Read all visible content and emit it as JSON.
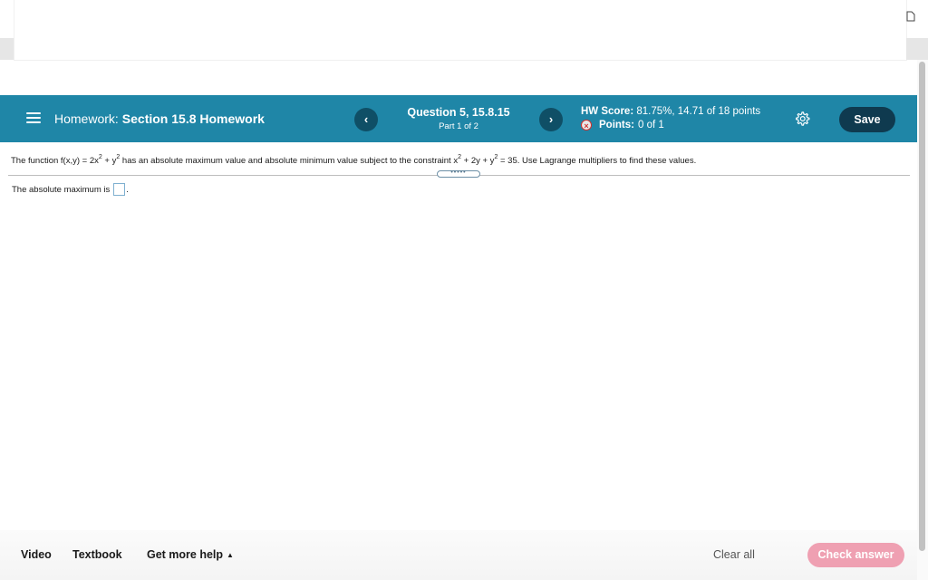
{
  "header": {
    "homework_prefix": "Homework:",
    "homework_name": "Section 15.8 Homework",
    "prev_icon": "chevron-left-icon",
    "next_icon": "chevron-right-icon",
    "prev_glyph": "‹",
    "next_glyph": "›",
    "question_title": "Question 5, 15.8.15",
    "question_part": "Part 1 of 2",
    "hw_score_label": "HW Score:",
    "hw_score_value": "81.75%, 14.71 of 18 points",
    "points_label": "Points:",
    "points_value": "0 of 1",
    "save_label": "Save",
    "colors": {
      "bar": "#1f86a7",
      "nav_button": "#0f4f66",
      "save_button": "#0f3a4f"
    }
  },
  "problem": {
    "part1": "The function f(x,y) = 2x",
    "sup1": "2",
    "part2": " + y",
    "sup2": "2",
    "part3": "  has an absolute maximum value and absolute minimum value subject to the constraint x",
    "sup3": "2",
    "part4": " + 2y + y",
    "sup4": "2",
    "part5": " = 35. Use Lagrange multipliers to find these values.",
    "expand_dots": "•••••"
  },
  "answer": {
    "prompt": "The absolute maximum is",
    "value": "",
    "trailing": "."
  },
  "footer": {
    "video_label": "Video",
    "textbook_label": "Textbook",
    "help_label": "Get more help",
    "help_caret": "▲",
    "clear_label": "Clear all",
    "check_label": "Check answer",
    "check_color": "#efa0b2"
  }
}
